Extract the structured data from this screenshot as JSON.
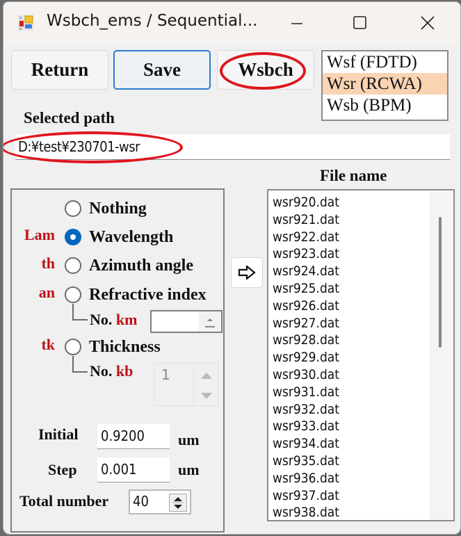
{
  "window": {
    "title": "Wsbch_ems / Sequential...",
    "icon": "app-grid-icon",
    "controls": [
      "minimize-icon",
      "maximize-icon",
      "close-icon"
    ]
  },
  "toolbar": {
    "return_label": "Return",
    "save_label": "Save",
    "wsbch_label": "Wsbch"
  },
  "method_list": {
    "items": [
      "Wsf (FDTD)",
      "Wsr (RCWA)",
      "Wsb (BPM)"
    ],
    "selected": "Wsr (RCWA)"
  },
  "path": {
    "label": "Selected path",
    "value": "D:¥test¥230701-wsr"
  },
  "parameters": {
    "options": [
      {
        "tag": "",
        "label": "Nothing",
        "checked": false
      },
      {
        "tag": "Lam",
        "label": "Wavelength",
        "checked": true
      },
      {
        "tag": "th",
        "label": "Azimuth angle",
        "checked": false
      },
      {
        "tag": "an",
        "label": "Refractive index",
        "checked": false
      },
      {
        "tag": "tk",
        "label": "Thickness",
        "checked": false
      }
    ],
    "km": {
      "prefix": "No.",
      "tag": "km",
      "value": ""
    },
    "kb": {
      "prefix": "No.",
      "tag": "kb",
      "value": "1"
    },
    "initial": {
      "label": "Initial",
      "value": "0.9200",
      "unit": "um"
    },
    "step": {
      "label": "Step",
      "value": "0.001",
      "unit": "um"
    },
    "total": {
      "label": "Total number",
      "value": "40"
    }
  },
  "arrow_button_icon": "right-arrow-icon",
  "files": {
    "header": "File name",
    "items": [
      "wsr920.dat",
      "wsr921.dat",
      "wsr922.dat",
      "wsr923.dat",
      "wsr924.dat",
      "wsr925.dat",
      "wsr926.dat",
      "wsr927.dat",
      "wsr928.dat",
      "wsr929.dat",
      "wsr930.dat",
      "wsr931.dat",
      "wsr932.dat",
      "wsr933.dat",
      "wsr934.dat",
      "wsr935.dat",
      "wsr936.dat",
      "wsr937.dat",
      "wsr938.dat"
    ]
  },
  "annotation_color": "#e0161e",
  "accent_color": "#0067c0",
  "tag_color": "#c0101a",
  "selection_color": "#fad3b3"
}
